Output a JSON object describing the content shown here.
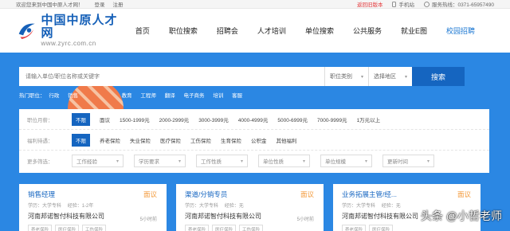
{
  "topbar": {
    "welcome": "欢迎您来到中国中原人才网！",
    "login": "登录",
    "register": "注册",
    "return_old": "返回旧版本",
    "mobile": "手机站",
    "hotline": "服务热线：0371-65957490"
  },
  "logo": {
    "name": "中国中原人才网",
    "url": "www.zyrc.com.cn"
  },
  "nav": [
    "首页",
    "职位搜索",
    "招聘会",
    "人才培训",
    "单位搜索",
    "公共服务",
    "就业E图",
    "校园招聘"
  ],
  "search": {
    "placeholder": "请输入单位/职位名称或关键字",
    "job_category": "职位类别",
    "region": "选择地区",
    "button": "搜索"
  },
  "hot": {
    "label": "热门职位：",
    "items": [
      "行政",
      "销售",
      "",
      "",
      "教育",
      "工程师",
      "翻译",
      "电子商务",
      "培训",
      "客服"
    ]
  },
  "filters": {
    "salary": {
      "label": "职位月薪：",
      "options": [
        "不限",
        "面议",
        "1500-1999元",
        "2000-2999元",
        "3000-3999元",
        "4000-4999元",
        "5000-6999元",
        "7000-9999元",
        "1万元以上"
      ]
    },
    "benefits": {
      "label": "福利待遇：",
      "options": [
        "不限",
        "养老保险",
        "失业保险",
        "医疗保险",
        "工伤保险",
        "生育保险",
        "公积金",
        "其他福利"
      ]
    },
    "more": {
      "label": "更多筛选：",
      "options": [
        "工作经验",
        "学历要求",
        "工作性质",
        "单位性质",
        "单位规模",
        "更新时间"
      ]
    }
  },
  "jobs": [
    {
      "title": "销售经理",
      "salary": "面议",
      "education": "学历：大学专科",
      "experience": "经验：1-2年",
      "company": "河南邦诺智付科技有限公司",
      "time": "5小时前",
      "tags": [
        "养老保险",
        "医疗保险",
        "工伤保险"
      ]
    },
    {
      "title": "渠道/分销专员",
      "salary": "面议",
      "education": "学历：大学专科",
      "experience": "经验：无",
      "company": "河南邦诺智付科技有限公司",
      "time": "5小时前",
      "tags": [
        "养老保险",
        "医疗保险",
        "工伤保险"
      ]
    },
    {
      "title": "业务拓展主管/经...",
      "salary": "面议",
      "education": "学历：大学专科",
      "experience": "经验：无",
      "company": "河南邦诺智付科技有限公司",
      "time": "",
      "tags": [
        "养老保险",
        "医疗保险"
      ]
    }
  ],
  "watermark": "头条 @小哲老师",
  "colors": {
    "brand_blue": "#2b87e3",
    "button_blue": "#1565c0",
    "salary_orange": "#f39a3b",
    "alert_red": "#e4393c"
  }
}
